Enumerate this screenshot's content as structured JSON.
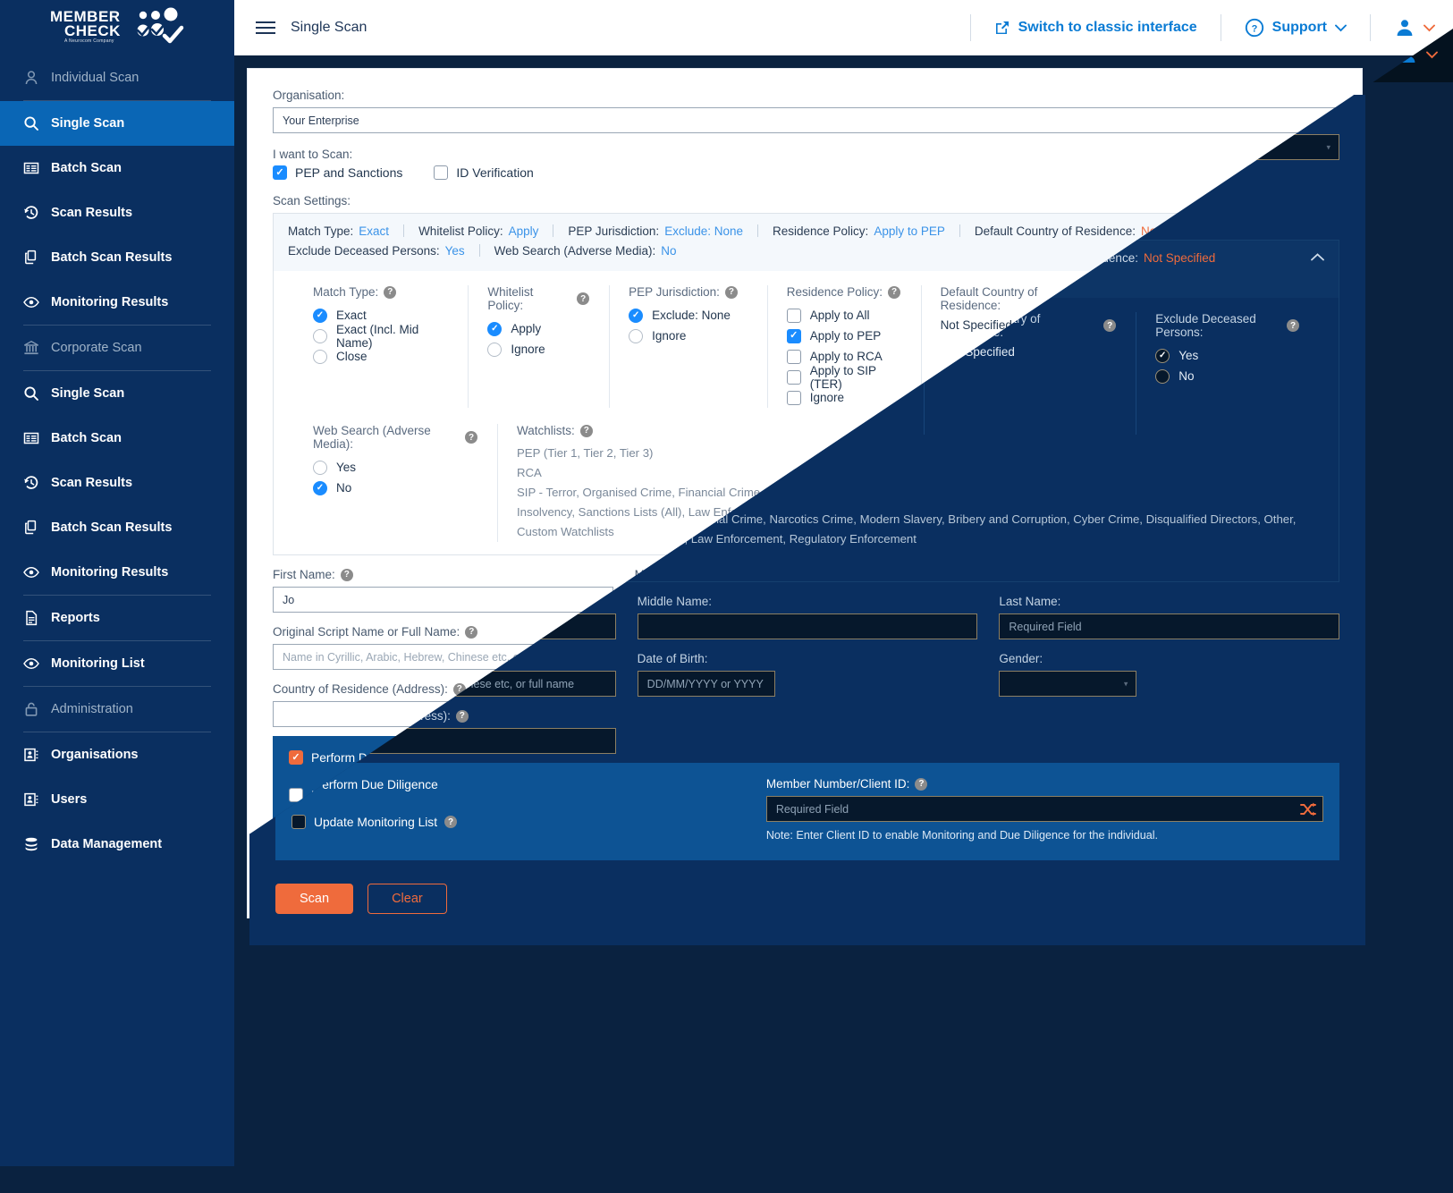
{
  "brand": {
    "line1": "MEMBER",
    "line2": "CHECK",
    "tagline": "A Neurocom Company"
  },
  "topbar": {
    "menu_icon": "hamburger-icon",
    "title": "Single Scan",
    "switch_label": "Switch to classic interface",
    "support_label": "Support",
    "external_icon": "external-link-icon",
    "help_icon": "question-circle-icon",
    "user_icon": "user-avatar-icon",
    "chevron_icon": "chevron-down-icon"
  },
  "sidebar": {
    "groups": [
      {
        "header": "Individual Scan",
        "header_icon": "person-icon",
        "items": [
          {
            "label": "Single Scan",
            "icon": "search-icon",
            "active": true
          },
          {
            "label": "Batch Scan",
            "icon": "list-icon",
            "active": false
          },
          {
            "label": "Scan Results",
            "icon": "history-icon",
            "active": false
          },
          {
            "label": "Batch Scan Results",
            "icon": "copy-icon",
            "active": false
          },
          {
            "label": "Monitoring Results",
            "icon": "eye-icon",
            "active": false
          }
        ]
      },
      {
        "header": "Corporate Scan",
        "header_icon": "bank-icon",
        "items": [
          {
            "label": "Single Scan",
            "icon": "search-icon",
            "active": false
          },
          {
            "label": "Batch Scan",
            "icon": "list-icon",
            "active": false
          },
          {
            "label": "Scan Results",
            "icon": "history-icon",
            "active": false
          },
          {
            "label": "Batch Scan Results",
            "icon": "copy-icon",
            "active": false
          },
          {
            "label": "Monitoring Results",
            "icon": "eye-icon",
            "active": false
          }
        ]
      },
      {
        "header": "",
        "header_icon": "",
        "items": [
          {
            "label": "Reports",
            "icon": "document-icon",
            "active": false
          }
        ]
      },
      {
        "header": "",
        "header_icon": "",
        "items": [
          {
            "label": "Monitoring List",
            "icon": "eye-icon",
            "active": false
          }
        ]
      },
      {
        "header": "Administration",
        "header_icon": "lock-icon",
        "items": [
          {
            "label": "Organisations",
            "icon": "contact-card-icon",
            "active": false
          },
          {
            "label": "Users",
            "icon": "contact-card-icon",
            "active": false
          },
          {
            "label": "Data Management",
            "icon": "database-icon",
            "active": false
          }
        ]
      }
    ]
  },
  "form": {
    "organisation_label": "Organisation:",
    "organisation_value": "Your Enterprise",
    "i_want_to_scan_label": "I want to Scan:",
    "pep_sanctions_label": "PEP and Sanctions",
    "pep_sanctions_checked": true,
    "id_verification_label": "ID Verification",
    "id_verification_checked": false,
    "scan_settings_label": "Scan Settings:"
  },
  "summary": {
    "row1": [
      {
        "key": "Match Type:",
        "value": "Exact",
        "warn": false
      },
      {
        "key": "Whitelist Policy:",
        "value": "Apply",
        "warn": false
      },
      {
        "key": "PEP Jurisdiction:",
        "value": "Exclude: None",
        "warn": false
      },
      {
        "key": "Residence Policy:",
        "value": "Apply to PEP",
        "warn": false
      },
      {
        "key": "Default Country of Residence:",
        "value": "Not Specified",
        "warn": true
      }
    ],
    "row2": [
      {
        "key": "Exclude Deceased Persons:",
        "value": "Yes",
        "warn": false
      },
      {
        "key": "Web Search (Adverse Media):",
        "value": "No",
        "warn": false
      }
    ],
    "collapse_icon": "chevron-up-icon"
  },
  "settings": {
    "match_type": {
      "title": "Match Type:",
      "options": [
        "Exact",
        "Exact (Incl. Mid Name)",
        "Close"
      ],
      "selected": "Exact"
    },
    "whitelist_policy": {
      "title": "Whitelist Policy:",
      "options": [
        "Apply",
        "Ignore"
      ],
      "selected": "Apply"
    },
    "pep_jurisdiction": {
      "title": "PEP Jurisdiction:",
      "options": [
        "Exclude: None",
        "Ignore"
      ],
      "selected": "Exclude: None"
    },
    "residence_policy": {
      "title": "Residence Policy:",
      "options": [
        "Apply to All",
        "Apply to PEP",
        "Apply to RCA",
        "Apply to SIP (TER)",
        "Ignore"
      ],
      "checked": [
        "Apply to PEP"
      ]
    },
    "default_country": {
      "title": "Default Country of Residence:",
      "value": "Not Specified"
    },
    "exclude_deceased": {
      "title": "Exclude Deceased Persons:",
      "options": [
        "Yes",
        "No"
      ],
      "selected": "Yes"
    },
    "web_search": {
      "title": "Web Search (Adverse Media):",
      "options": [
        "Yes",
        "No"
      ],
      "selected": "No"
    },
    "watchlists": {
      "title": "Watchlists:",
      "items": [
        "PEP (Tier 1, Tier 2, Tier 3)",
        "RCA",
        "SIP - Terror, Organised Crime, Financial Crime, Narcotics Crime, Modern Slavery, Bribery and Corruption, Cyber Crime, Disqualified Directors, Other, Insolvency, Sanctions Lists (All), Law Enforcement, Regulatory Enforcement",
        "Custom Watchlists"
      ]
    }
  },
  "fields": {
    "first_name_label": "First Name:",
    "first_name_value": "Jo",
    "middle_name_label": "Middle Name:",
    "middle_name_value": "",
    "last_name_label": "Last Name:",
    "last_name_placeholder": "Required Field",
    "original_script_label": "Original Script Name or Full Name:",
    "original_script_placeholder": "Name in Cyrillic, Arabic, Hebrew, Chinese etc, or full name",
    "dob_label": "Date of Birth:",
    "dob_placeholder": "DD/MM/YYYY or YYYY",
    "gender_label": "Gender:",
    "gender_value": "",
    "country_residence_label": "Country of Residence (Address):",
    "country_residence_value": ""
  },
  "due_diligence": {
    "perform_label": "Perform Due Diligence",
    "perform_checked": true,
    "update_monitoring_label": "Update Monitoring List",
    "update_monitoring_checked": false,
    "member_number_label": "Member Number/Client ID:",
    "member_number_placeholder": "Required Field",
    "shuffle_icon": "shuffle-icon",
    "note": "Note: Enter Client ID to enable Monitoring and Due Diligence for the individual."
  },
  "actions": {
    "scan_label": "Scan",
    "clear_label": "Clear"
  },
  "colors": {
    "sidebar": "#0a2f60",
    "sidebar_active": "#0a66b5",
    "accent_blue": "#1a8cff",
    "accent_orange": "#ef6b3c",
    "link_blue": "#3b93e8",
    "dd_panel": "#0d5394",
    "dark_bg": "#0a2240"
  }
}
